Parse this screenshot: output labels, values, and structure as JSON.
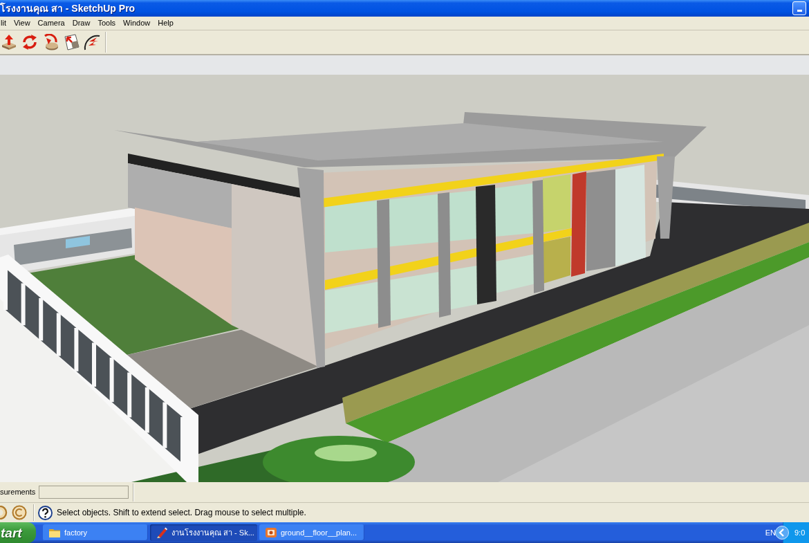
{
  "window": {
    "title": "โรงงานคุณ สา - SketchUp Pro"
  },
  "menu": [
    "lit",
    "View",
    "Camera",
    "Draw",
    "Tools",
    "Window",
    "Help"
  ],
  "measurements": {
    "label": "surements"
  },
  "status_bar": {
    "hint": "Select objects. Shift to extend select. Drag mouse to select multiple."
  },
  "taskbar": {
    "start": "tart",
    "tasks": [
      {
        "label": "factory",
        "kind": "folder",
        "selected": false
      },
      {
        "label": "งานโรงงานคุณ สา - Sk...",
        "kind": "sketchup",
        "selected": true
      },
      {
        "label": "ground__floor__plan...",
        "kind": "image",
        "selected": false
      }
    ],
    "tray": {
      "language": "EN",
      "clock": "9:0"
    }
  }
}
